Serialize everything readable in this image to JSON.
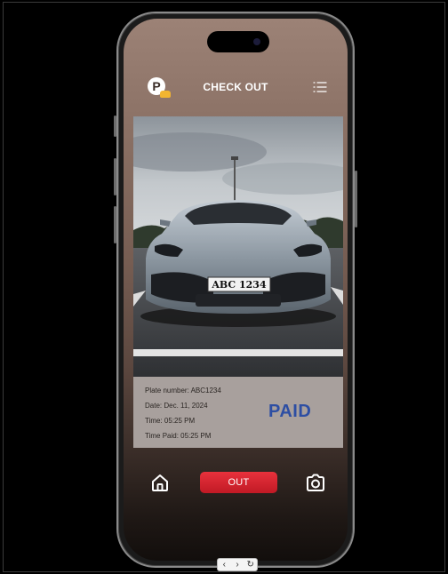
{
  "header": {
    "title": "CHECK OUT",
    "logo_letter": "P",
    "menu_icon": "list-menu-icon"
  },
  "vehicle_photo": {
    "plate_text": "ABC 1234"
  },
  "details": {
    "plate": "Plate number: ABC1234",
    "date": "Date: Dec. 11, 2024",
    "time": "Time: 05:25 PM",
    "time_paid": "Time Paid: 05:25 PM",
    "status": "PAID"
  },
  "bottom_nav": {
    "home_icon": "home-icon",
    "out_label": "OUT",
    "camera_icon": "camera-icon"
  },
  "viewer": {
    "prev": "‹",
    "next": "›",
    "rotate": "↻"
  },
  "colors": {
    "accent_red": "#d7262f",
    "paid_blue": "#2d4ea3",
    "logo_yellow": "#f2b531"
  }
}
